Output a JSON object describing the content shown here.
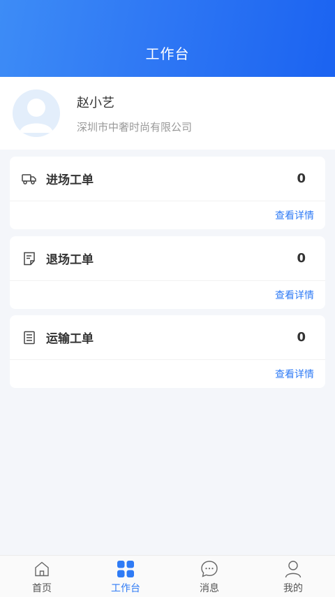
{
  "header": {
    "title": "工作台"
  },
  "profile": {
    "name": "赵小艺",
    "company": "深圳市中奢时尚有限公司",
    "avatar_icon": "user-avatar-icon"
  },
  "cards": [
    {
      "icon": "truck-icon",
      "title": "进场工单",
      "count": "0",
      "link": "查看详情"
    },
    {
      "icon": "document-icon",
      "title": "退场工单",
      "count": "0",
      "link": "查看详情"
    },
    {
      "icon": "list-icon",
      "title": "运输工单",
      "count": "0",
      "link": "查看详情"
    }
  ],
  "tabbar": {
    "items": [
      {
        "label": "首页",
        "icon": "home-icon"
      },
      {
        "label": "工作台",
        "icon": "grid-icon",
        "active": true
      },
      {
        "label": "消息",
        "icon": "message-icon"
      },
      {
        "label": "我的",
        "icon": "person-icon"
      }
    ]
  },
  "colors": {
    "accent": "#2f7bf5",
    "header_start": "#3d8cf6",
    "header_end": "#1b63f1"
  }
}
